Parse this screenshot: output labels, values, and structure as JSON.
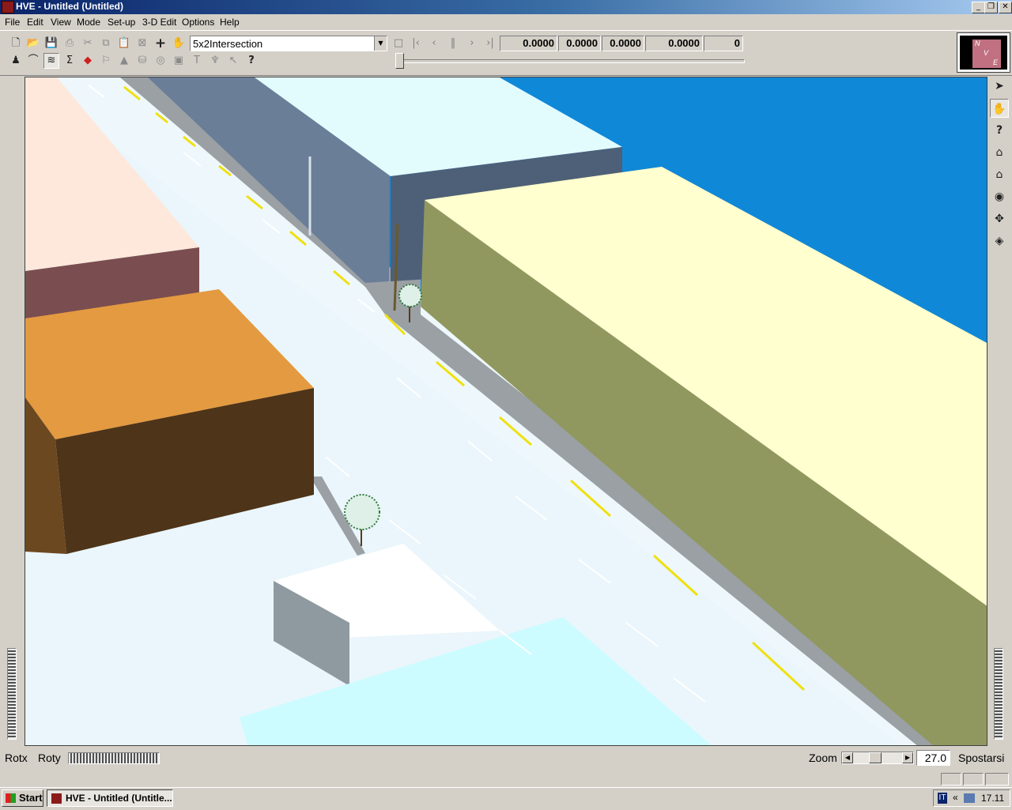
{
  "window": {
    "title": "HVE - Untitled (Untitled)",
    "controls": {
      "minimize": "_",
      "restore": "❐",
      "close": "✕"
    }
  },
  "menu": [
    "File",
    "Edit",
    "View",
    "Mode",
    "Set-up",
    "3-D Edit",
    "Options",
    "Help"
  ],
  "toolbar": {
    "row1_icons": [
      "new-icon",
      "open-icon",
      "save-icon",
      "print-icon",
      "cut-icon",
      "copy-icon",
      "paste-icon",
      "delete-icon",
      "add-icon",
      "hand-icon"
    ],
    "row2_icons": [
      "select-object-icon",
      "path-icon",
      "terrain-icon",
      "sigma-icon",
      "red-arrows-icon",
      "flag-icon",
      "cone-icon",
      "barrel-icon",
      "target-icon",
      "box-icon",
      "sign-icon",
      "light-pole-icon",
      "arrow-small-icon",
      "help-icon"
    ],
    "environment_combo": "5x2Intersection",
    "playback": [
      "stop-icon",
      "first-icon",
      "previous-icon",
      "pause-icon",
      "next-icon",
      "last-icon"
    ],
    "readouts": [
      "0.0000",
      "0.0000",
      "0.0000",
      "0.0000",
      "0"
    ],
    "time_slider_position": 0
  },
  "compass": {
    "n": "N",
    "v": "V",
    "e": "E"
  },
  "right_tools": [
    "pointer-icon",
    "pan-hand-icon",
    "query-icon",
    "home-icon",
    "home-set-icon",
    "eye-icon",
    "move-icon",
    "perspective-icon"
  ],
  "bottom": {
    "rotx_label": "Rotx",
    "roty_label": "Roty",
    "zoom_label": "Zoom",
    "zoom_value": "27.0",
    "move_label": "Spostarsi"
  },
  "taskbar": {
    "start": "Start",
    "task_item": "HVE - Untitled (Untitle...",
    "ime": "IT",
    "tray_chevron": "«",
    "clock": "17.11"
  },
  "colors": {
    "sky": "#1088d8",
    "road": "#eaf6fb",
    "sidewalk": "#9aa0a4",
    "lane_yellow": "#f0e010",
    "building_yellow_top": "#ffffd0",
    "building_yellow_side": "#909860",
    "building_orange_top": "#e49a40",
    "building_orange_side": "#4e3418",
    "building_blue_side": "#6a7e98",
    "building_pink_top": "#fee8dc",
    "building_pink_side": "#7a4e50",
    "building_cyan_top": "#ccfcff"
  }
}
